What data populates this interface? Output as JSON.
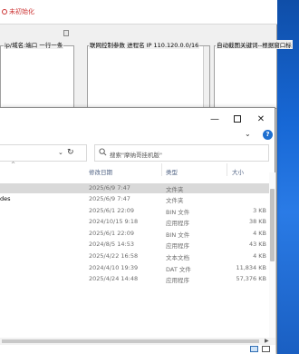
{
  "background_app": {
    "status_text": "未初始化",
    "panes": [
      {
        "label": "ip/域名:端口  一行一条"
      },
      {
        "label": "联网控制参数  进程名 IP  110.120.0.0/16"
      },
      {
        "label": "自动截图关键词--根据窗口标"
      }
    ]
  },
  "explorer": {
    "window_controls": {
      "minimize": "—",
      "close": "✕"
    },
    "search": {
      "placeholder": "搜索\"摩纳哥挂机版\""
    },
    "columns": {
      "date": "修改日期",
      "type": "类型",
      "size": "大小"
    },
    "rows": [
      {
        "name": "",
        "date": "2025/6/9 7:47",
        "type": "文件夹",
        "size": "",
        "selected": true
      },
      {
        "name": "des",
        "date": "2025/6/9 7:47",
        "type": "文件夹",
        "size": "",
        "selected": false
      },
      {
        "name": "",
        "date": "2025/6/1 22:09",
        "type": "BIN 文件",
        "size": "3 KB",
        "selected": false
      },
      {
        "name": "",
        "date": "2024/10/15 9:18",
        "type": "应用程序",
        "size": "38 KB",
        "selected": false
      },
      {
        "name": "",
        "date": "2025/6/1 22:09",
        "type": "BIN 文件",
        "size": "4 KB",
        "selected": false
      },
      {
        "name": "",
        "date": "2024/8/5 14:53",
        "type": "应用程序",
        "size": "43 KB",
        "selected": false
      },
      {
        "name": "",
        "date": "2025/4/22 16:58",
        "type": "文本文档",
        "size": "4 KB",
        "selected": false
      },
      {
        "name": "",
        "date": "2024/4/10 19:39",
        "type": "DAT 文件",
        "size": "11,834 KB",
        "selected": false
      },
      {
        "name": "",
        "date": "2025/4/24 14:48",
        "type": "应用程序",
        "size": "57,376 KB",
        "selected": false
      }
    ]
  },
  "colors": {
    "accent": "#1e6fd0",
    "selection": "#d9d9d9",
    "header_text": "#4d6082"
  }
}
